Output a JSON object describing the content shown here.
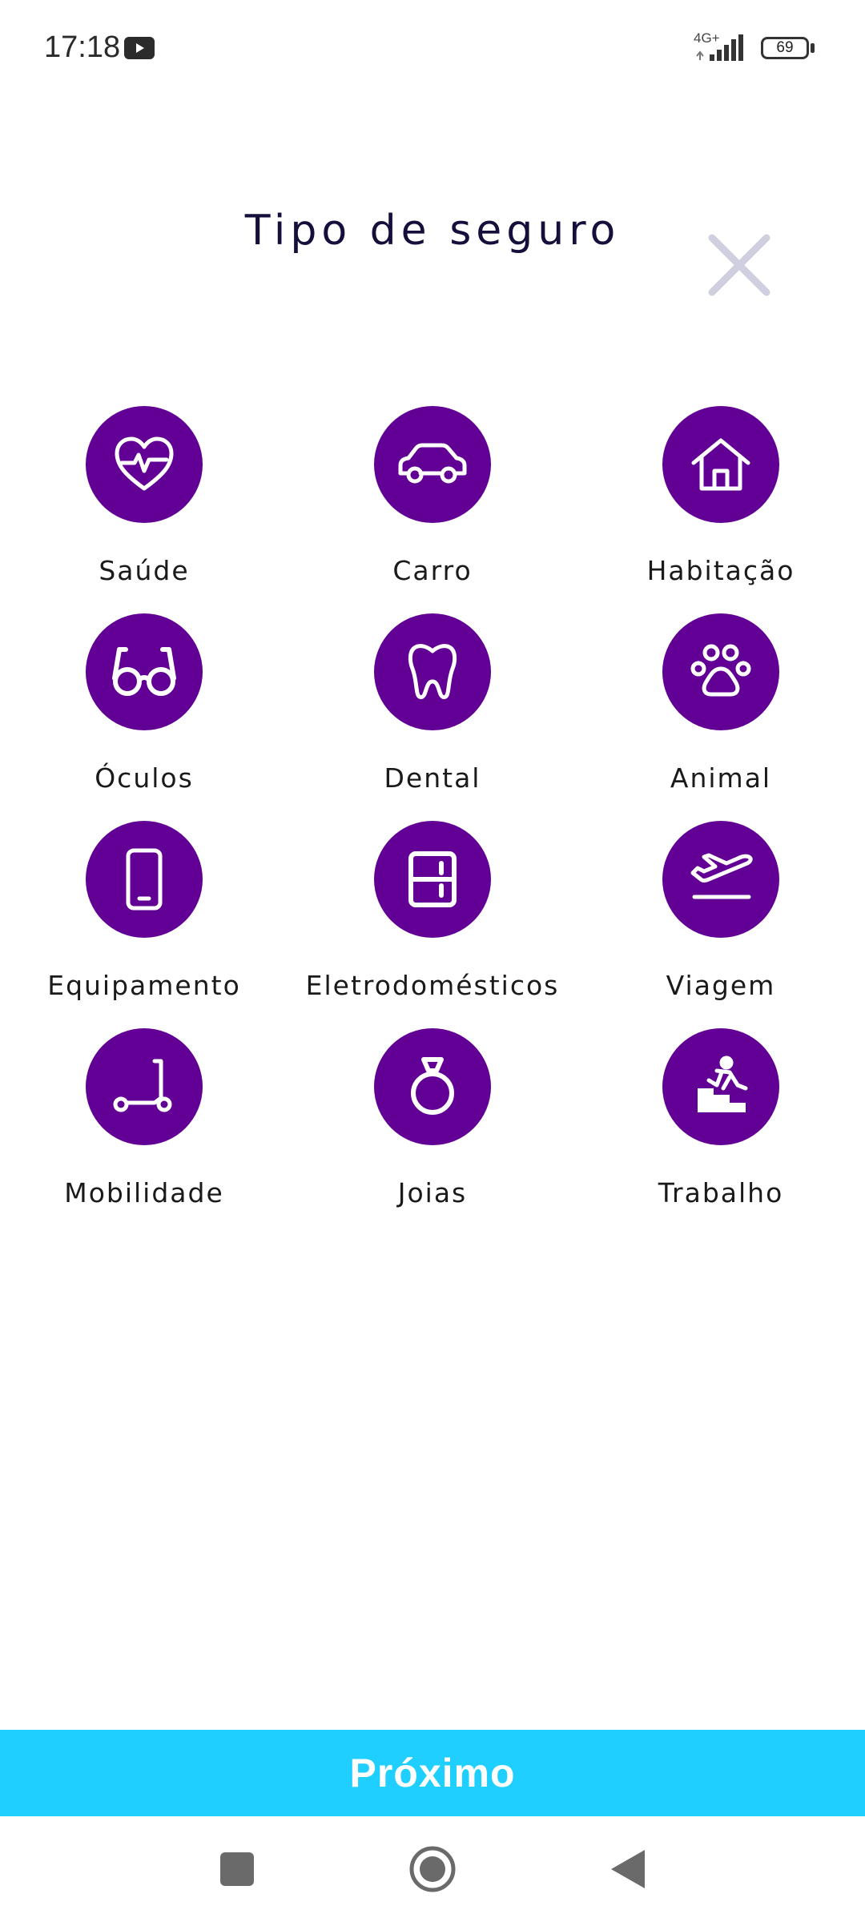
{
  "status_bar": {
    "time": "17:18",
    "network": "4G+",
    "battery": "69",
    "notification_icon": "youtube-icon"
  },
  "header": {
    "title": "Tipo de seguro",
    "close_icon": "close-icon"
  },
  "categories": [
    {
      "label": "Saúde",
      "icon": "heart-pulse-icon"
    },
    {
      "label": "Carro",
      "icon": "car-icon"
    },
    {
      "label": "Habitação",
      "icon": "house-icon"
    },
    {
      "label": "Óculos",
      "icon": "glasses-icon"
    },
    {
      "label": "Dental",
      "icon": "tooth-icon"
    },
    {
      "label": "Animal",
      "icon": "paw-icon"
    },
    {
      "label": "Equipamento",
      "icon": "smartphone-icon"
    },
    {
      "label": "Eletrodomésticos",
      "icon": "appliance-icon"
    },
    {
      "label": "Viagem",
      "icon": "airplane-takeoff-icon"
    },
    {
      "label": "Mobilidade",
      "icon": "scooter-icon"
    },
    {
      "label": "Joias",
      "icon": "ring-icon"
    },
    {
      "label": "Trabalho",
      "icon": "stairs-fall-icon"
    }
  ],
  "footer": {
    "next_label": "Próximo"
  },
  "colors": {
    "accent": "#620096",
    "button": "#1ecfff",
    "title": "#14103b",
    "close": "#cfcfe0"
  }
}
